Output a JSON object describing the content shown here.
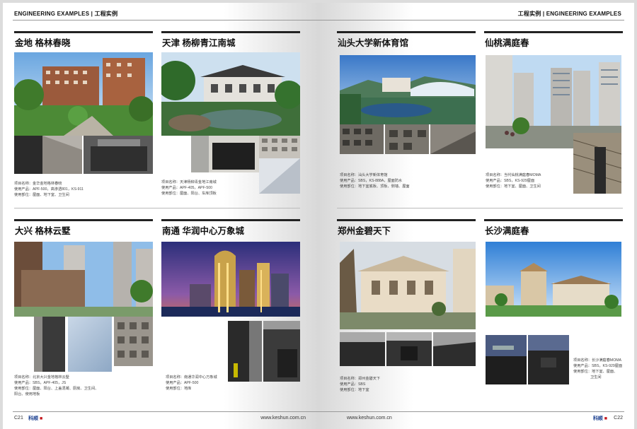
{
  "left_page": {
    "header": "ENGINEERING EXAMPLES | 工程实例",
    "page_number": "C21",
    "website": "www.keshun.com.cn",
    "panels": [
      {
        "title": "金地 格林春晓",
        "caption": [
          "项目名称：金华金地格林春晓",
          "使用产品：APF-500，高渗透801，KS-911",
          "使用部位：屋面、地下室、卫生间"
        ]
      },
      {
        "title": "天津 杨柳青江南城",
        "caption": [
          "项目名称：天津杨柳青金地江南城",
          "使用产品：APF-405，APF-500",
          "使用部位：屋面、阳台、车库顶板"
        ]
      },
      {
        "title": "大兴 格林云墅",
        "caption": [
          "项目名称：北京大兴金地格林云墅",
          "使用产品：SBS，APF-405，JS",
          "使用部位：屋面、阳台、上盖混凝、厨房、卫生间、",
          "阳台、使用地板"
        ]
      },
      {
        "title": "南通 华润中心万象城",
        "caption": [
          "项目名称：南通华润中心万象城",
          "使用产品：APF-500",
          "使用部位：地库"
        ]
      }
    ]
  },
  "right_page": {
    "header": "工程实例 | ENGINEERING EXAMPLES",
    "page_number": "C22",
    "website": "www.keshun.com.cn",
    "panels": [
      {
        "title": "汕头大学新体育馆",
        "caption": [
          "项目名称：汕头大学新体育馆",
          "使用产品：SBS，KS-888A，屋面防水",
          "使用部位：地下室底板、顶板、侧墙、屋面"
        ]
      },
      {
        "title": "仙桃满庭春",
        "caption": [
          "项目名称：当代仙桃满庭春MOMA",
          "使用产品：SBS，KS-929屋面",
          "使用部位：地下室、屋面、卫生间"
        ]
      },
      {
        "title": "郑州金碧天下",
        "caption": [
          "项目名称：郑州金碧天下",
          "使用产品：SBS",
          "使用部位：地下室"
        ]
      },
      {
        "title": "长沙满庭春",
        "caption": [
          "项目名称：长沙满庭春MOMA",
          "使用产品：SBS，KS-929屋面",
          "使用部位：地下室、屋面、",
          "卫生间"
        ]
      }
    ]
  },
  "brand": {
    "logo_text": "科顺",
    "accent": "#1a3f8f",
    "red": "#c4161c"
  }
}
